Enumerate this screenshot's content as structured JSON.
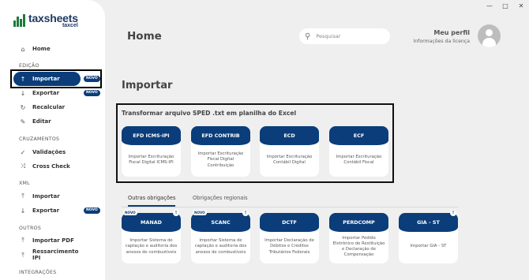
{
  "window": {
    "minimize": "—",
    "maximize": "□",
    "close": "✕"
  },
  "logo": {
    "name": "taxsheets",
    "sub": "taxcel"
  },
  "sidebar": {
    "home": {
      "label": "Home",
      "icon": "house-icon"
    },
    "sections": {
      "edicao": "EDIÇÃO",
      "cruzamentos": "CRUZAMENTOS",
      "xml": "XML",
      "outros": "OUTROS",
      "integracoes": "INTEGRAÇÕES"
    },
    "edicao_items": [
      {
        "label": "Importar",
        "icon": "upload-icon",
        "badge": "NOVO"
      },
      {
        "label": "Exportar",
        "icon": "download-icon",
        "badge": "NOVO"
      },
      {
        "label": "Recalcular",
        "icon": "refresh-icon"
      },
      {
        "label": "Editar",
        "icon": "pencil-icon"
      }
    ],
    "cruzamentos_items": [
      {
        "label": "Validações",
        "icon": "check-icon"
      },
      {
        "label": "Cross Check",
        "icon": "shuffle-icon"
      }
    ],
    "xml_items": [
      {
        "label": "Importar",
        "icon": "upload-icon"
      },
      {
        "label": "Exportar",
        "icon": "download-icon",
        "badge": "NOVO"
      }
    ],
    "outros_items": [
      {
        "label": "Importar PDF",
        "icon": "upload-icon"
      },
      {
        "label": "Ressarcimento IPI",
        "icon": "upload-icon"
      }
    ]
  },
  "header": {
    "title": "Home",
    "search_placeholder": "Pesquisar",
    "profile_name": "Meu perfil",
    "profile_sub": "Informações da licença"
  },
  "main": {
    "heading": "Importar",
    "sped_title": "Transformar arquivo SPED .txt em planilha do Excel",
    "sped_cards": [
      {
        "title": "EFD ICMS-IPI",
        "desc": "Importar Escrituração Fiscal Digital ICMS-IPI"
      },
      {
        "title": "EFD CONTRIB",
        "desc": "Importar Escrituração Fiscal Digital Contribuição"
      },
      {
        "title": "ECD",
        "desc": "Importar Escrituração Contábil Digital"
      },
      {
        "title": "ECF",
        "desc": "Importar Escrituração Contábil Fiscal"
      }
    ],
    "tabs": [
      "Outras obrigações",
      "Obrigações regionais"
    ],
    "other_cards": [
      {
        "title": "MANAD",
        "desc": "Importar Sistema de captação e auditoria dos anexos de combustíveis",
        "badge": "NOVO",
        "info": "!"
      },
      {
        "title": "SCANC",
        "desc": "Importar Sistema de captação e auditoria dos anexos de combustíveis",
        "badge": "NOVO",
        "info": "!"
      },
      {
        "title": "DCTF",
        "desc": "Importar Declaração de Débitos e Créditos Tributários Federais"
      },
      {
        "title": "PERDCOMP",
        "desc": "Importar Pedido Eletrônico de Restituição e Declaração de Compensação"
      },
      {
        "title": "GIA - ST",
        "desc": "Importar GIA - ST",
        "info": "!"
      }
    ]
  },
  "colors": {
    "primary": "#0a3d7a",
    "logo_green": "#1f7a3b",
    "background": "#efefef"
  }
}
